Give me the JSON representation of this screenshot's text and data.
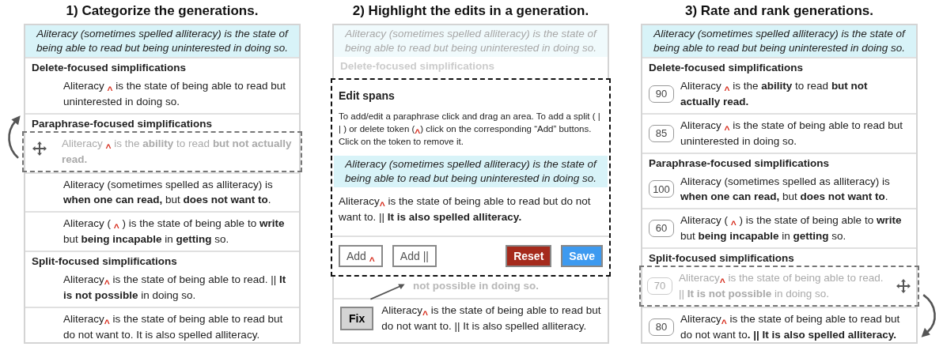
{
  "panels": [
    {
      "kind": "categorize",
      "title": "1) Categorize the generations.",
      "source": "Aliteracy (sometimes spelled alliteracy) is the state of being able to read but being uninterested in doing so.",
      "groups": [
        {
          "heading": "Delete-focused simplifications",
          "items": [
            {
              "dragging": false,
              "parts": [
                {
                  "kind": "text",
                  "text": "Aliteracy "
                },
                {
                  "kind": "caret",
                  "text": "^"
                },
                {
                  "kind": "text",
                  "text": " is the state of being able to read but uninterested in doing so."
                }
              ]
            }
          ]
        },
        {
          "heading": "Paraphrase-focused simplifications",
          "items": [
            {
              "dragging": true,
              "parts": [
                {
                  "kind": "text",
                  "text": "Aliteracy "
                },
                {
                  "kind": "caret",
                  "text": "^"
                },
                {
                  "kind": "text",
                  "text": " is the **ability** to read **but not actually read.**"
                }
              ]
            },
            {
              "dragging": false,
              "parts": [
                {
                  "kind": "text",
                  "text": "Aliteracy (sometimes spelled as alliteracy) is **when one can read,** but **does not want to**."
                }
              ]
            },
            {
              "dragging": false,
              "parts": [
                {
                  "kind": "text",
                  "text": "Aliteracy ( "
                },
                {
                  "kind": "caret",
                  "text": "^"
                },
                {
                  "kind": "text",
                  "text": " ) is the state of being able to **write** but **being incapable** in **getting** so."
                }
              ]
            }
          ]
        },
        {
          "heading": "Split-focused simplifications",
          "items": [
            {
              "dragging": false,
              "parts": [
                {
                  "kind": "text",
                  "text": "Aliteracy"
                },
                {
                  "kind": "caret",
                  "text": "^"
                },
                {
                  "kind": "text",
                  "text": " is the state of being able to read. || **It is not possible** in doing so."
                }
              ]
            },
            {
              "dragging": false,
              "parts": [
                {
                  "kind": "text",
                  "text": "Aliteracy"
                },
                {
                  "kind": "caret",
                  "text": "^"
                },
                {
                  "kind": "text",
                  "text": " is the state of being able to read but do not want to. It is also spelled alliteracy."
                }
              ]
            }
          ]
        }
      ]
    },
    {
      "kind": "edit",
      "title": "2) Highlight the edits in a generation.",
      "source": "Aliteracy (sometimes spelled alliteracy) is the state of being able to read but being uninterested in doing so.",
      "heading": "Delete-focused simplifications",
      "dialog": {
        "title": "Edit spans",
        "instructions": [
          {
            "kind": "text",
            "text": "To add/edit a paraphrase click and drag an area. To add a split ( | | ) or delete token ("
          },
          {
            "kind": "caret",
            "text": "^"
          },
          {
            "kind": "text",
            "text": ") click on the corresponding “Add” buttons. Click on the token to remove it."
          }
        ],
        "source": "Aliteracy (sometimes spelled alliteracy) is the state of being able to read but being uninterested in doing so.",
        "sentence": [
          {
            "kind": "text",
            "text": "Aliteracy"
          },
          {
            "kind": "caret",
            "text": "^"
          },
          {
            "kind": "text",
            "text": " is the state of being able to read but do not want to. || **It is also spelled alliteracy.**"
          }
        ],
        "buttons": [
          {
            "kind": "add",
            "parts": [
              {
                "kind": "text",
                "text": "Add "
              },
              {
                "kind": "caret",
                "text": "^"
              }
            ]
          },
          {
            "kind": "add",
            "parts": [
              {
                "kind": "text",
                "text": "Add ||"
              }
            ]
          },
          {
            "kind": "reset",
            "parts": [
              {
                "kind": "text",
                "text": "Reset"
              }
            ]
          },
          {
            "kind": "save",
            "parts": [
              {
                "kind": "text",
                "text": "Save"
              }
            ]
          }
        ]
      },
      "covered_text": "not possible in doing so.",
      "item": {
        "fix": "Fix",
        "parts": [
          {
            "kind": "text",
            "text": "Aliteracy"
          },
          {
            "kind": "caret",
            "text": "^"
          },
          {
            "kind": "text",
            "text": " is the state of being able to read but do not want to. || It is also spelled alliteracy."
          }
        ]
      }
    },
    {
      "kind": "rank",
      "title": "3) Rate and rank generations.",
      "source": "Aliteracy (sometimes spelled alliteracy) is the state of being able to read but being uninterested in doing so.",
      "groups": [
        {
          "heading": "Delete-focused simplifications",
          "items": [
            {
              "dragging": false,
              "score": "90",
              "parts": [
                {
                  "kind": "text",
                  "text": "Aliteracy "
                },
                {
                  "kind": "caret",
                  "text": "^"
                },
                {
                  "kind": "text",
                  "text": " is the **ability** to read **but not actually read.**"
                }
              ]
            },
            {
              "dragging": false,
              "score": "85",
              "parts": [
                {
                  "kind": "text",
                  "text": "Aliteracy "
                },
                {
                  "kind": "caret",
                  "text": "^"
                },
                {
                  "kind": "text",
                  "text": " is the state of being able to read but uninterested in doing so."
                }
              ]
            }
          ]
        },
        {
          "heading": "Paraphrase-focused simplifications",
          "items": [
            {
              "dragging": false,
              "score": "100",
              "parts": [
                {
                  "kind": "text",
                  "text": "Aliteracy (sometimes spelled as alliteracy) is **when one can read,** but **does not want to**."
                }
              ]
            },
            {
              "dragging": false,
              "score": "60",
              "parts": [
                {
                  "kind": "text",
                  "text": "Aliteracy ( "
                },
                {
                  "kind": "caret",
                  "text": "^"
                },
                {
                  "kind": "text",
                  "text": " ) is the state of being able to **write** but **being incapable** in **getting** so."
                }
              ]
            }
          ]
        },
        {
          "heading": "Split-focused simplifications",
          "items": [
            {
              "dragging": true,
              "score": "70",
              "parts": [
                {
                  "kind": "text",
                  "text": "Aliteracy"
                },
                {
                  "kind": "caret",
                  "text": "^"
                },
                {
                  "kind": "text",
                  "text": " is the state of being able to read. || **It is not possible** in doing so."
                }
              ]
            },
            {
              "dragging": false,
              "score": "80",
              "parts": [
                {
                  "kind": "text",
                  "text": "Aliteracy"
                },
                {
                  "kind": "caret",
                  "text": "^"
                },
                {
                  "kind": "text",
                  "text": " is the state of being able to read but do not want to**. || It is also spelled alliteracy.**"
                }
              ]
            }
          ]
        }
      ]
    }
  ]
}
